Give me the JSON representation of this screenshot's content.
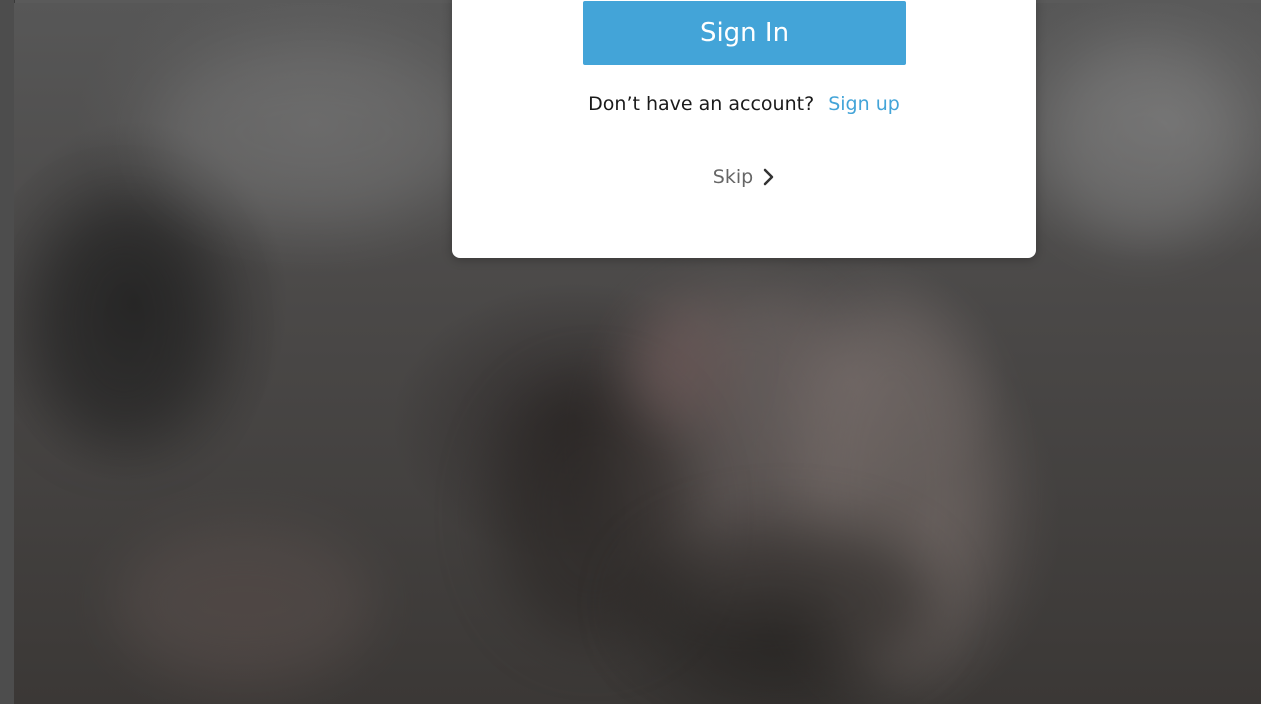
{
  "modal": {
    "signin_label": "Sign In",
    "account_prompt": "Don’t have an account?",
    "signup_label": "Sign up",
    "skip_label": "Skip"
  },
  "icons": {
    "skip": "chevron-right-icon"
  },
  "colors": {
    "accent": "#43a4d8",
    "modal_bg": "#ffffff",
    "backdrop": "#4a4a4a"
  }
}
